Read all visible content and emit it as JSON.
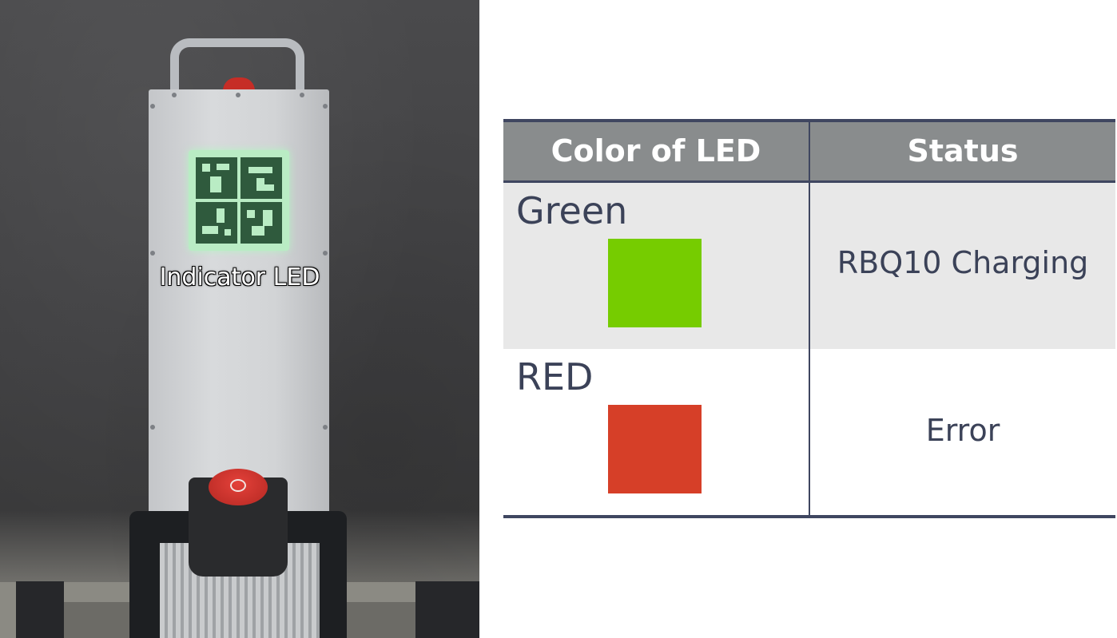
{
  "photo": {
    "label": "Indicator  LED"
  },
  "table": {
    "headers": [
      "Color of LED",
      "Status"
    ],
    "rows": [
      {
        "color_name": "Green",
        "swatch_color": "#76cc00",
        "status": "RBQ10 Charging"
      },
      {
        "color_name": "RED",
        "swatch_color": "#d63f28",
        "status": "Error"
      }
    ]
  },
  "colors": {
    "header_bg": "#898c8d",
    "row1_bg": "#e8e8e8",
    "rule": "#3f4660",
    "text": "#3b4258"
  }
}
